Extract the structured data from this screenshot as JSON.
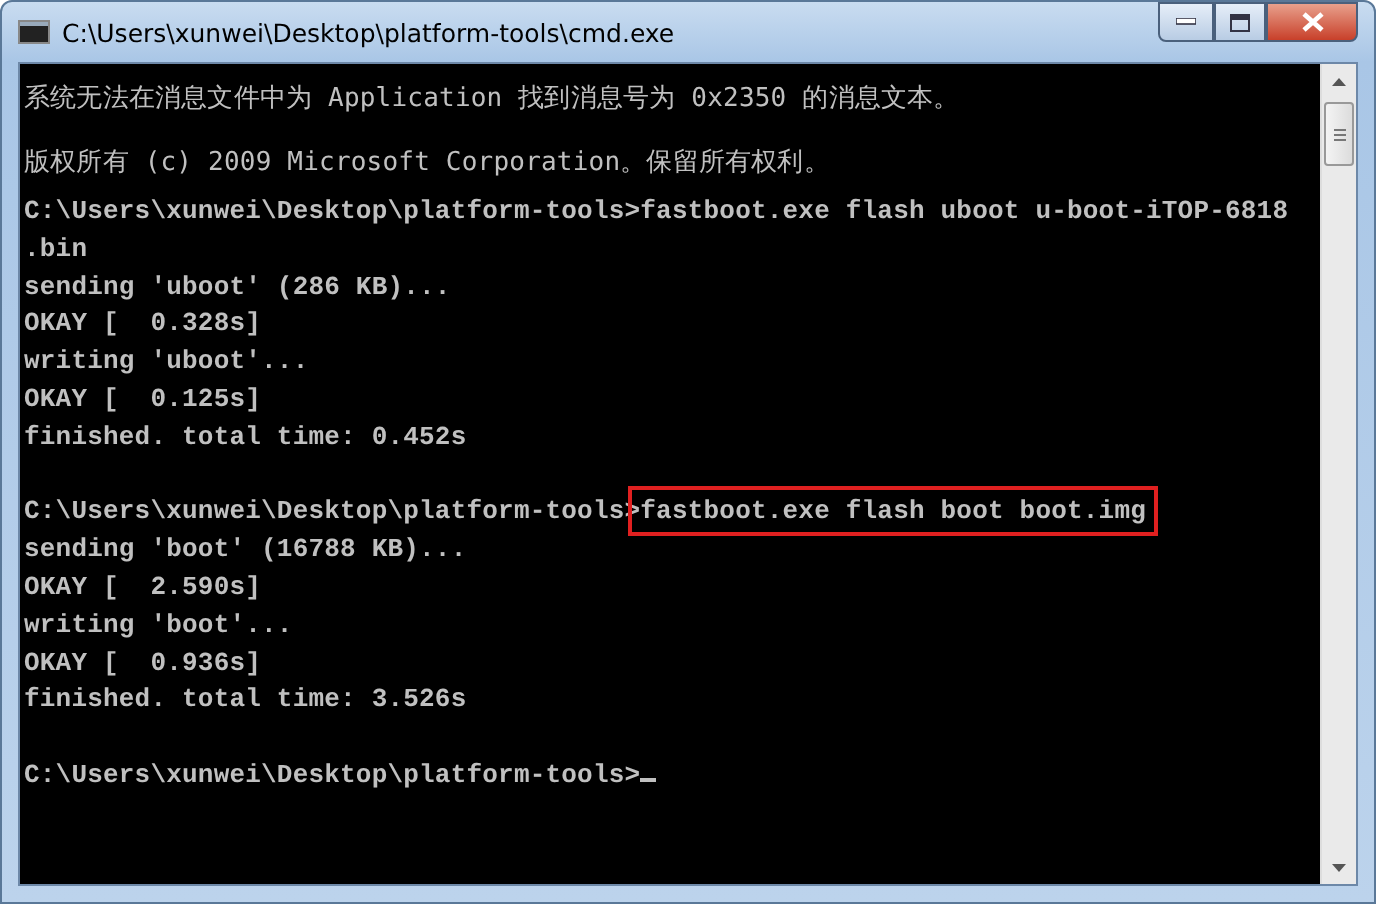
{
  "window": {
    "title": "C:\\Users\\xunwei\\Desktop\\platform-tools\\cmd.exe"
  },
  "lines": [
    {
      "kind": "wide",
      "text": "系统无法在消息文件中为 Application 找到消息号为 0x2350 的消息文本。"
    },
    {
      "kind": "wide",
      "text": "版权所有 (c) 2009 Microsoft Corporation。保留所有权利。"
    },
    {
      "kind": "command",
      "prompt": "C:\\Users\\xunwei\\Desktop\\platform-tools>",
      "command": "fastboot.exe flash uboot u-boot-iTOP-6818"
    },
    {
      "kind": "output",
      "text": ".bin"
    },
    {
      "kind": "output",
      "text": "sending 'uboot' (286 KB)..."
    },
    {
      "kind": "output",
      "text": "OKAY [  0.328s]"
    },
    {
      "kind": "output",
      "text": "writing 'uboot'..."
    },
    {
      "kind": "output",
      "text": "OKAY [  0.125s]"
    },
    {
      "kind": "output",
      "text": "finished. total time: 0.452s"
    },
    {
      "kind": "blank"
    },
    {
      "kind": "command",
      "prompt": "C:\\Users\\xunwei\\Desktop\\platform-tools>",
      "command": "fastboot.exe flash boot boot.img",
      "highlighted": true
    },
    {
      "kind": "output",
      "text": "sending 'boot' (16788 KB)..."
    },
    {
      "kind": "output",
      "text": "OKAY [  2.590s]"
    },
    {
      "kind": "output",
      "text": "writing 'boot'..."
    },
    {
      "kind": "output",
      "text": "OKAY [  0.936s]"
    },
    {
      "kind": "output",
      "text": "finished. total time: 3.526s"
    },
    {
      "kind": "blank"
    },
    {
      "kind": "command",
      "prompt": "C:\\Users\\xunwei\\Desktop\\platform-tools>",
      "cursor": true
    }
  ]
}
